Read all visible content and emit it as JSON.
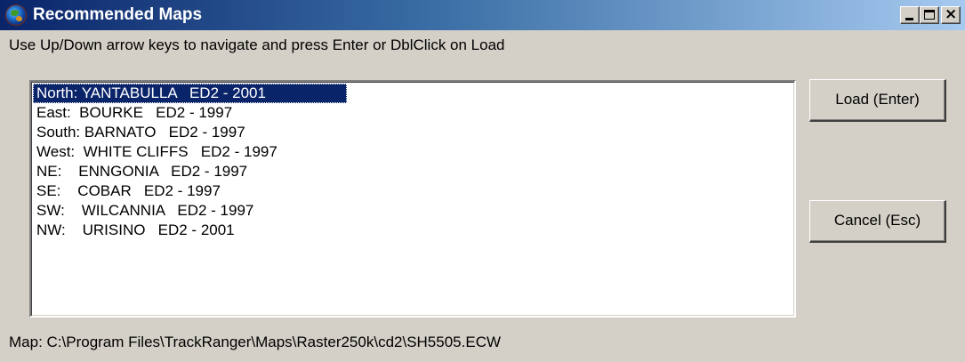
{
  "window": {
    "title": "Recommended Maps",
    "controls": {
      "minimize_icon": "minimize-icon",
      "maximize_icon": "maximize-icon",
      "close_icon": "close-icon",
      "close_glyph": "×"
    }
  },
  "instruction": "Use Up/Down arrow keys to navigate and press Enter or DblClick on Load",
  "maps_list": {
    "selected_index": 0,
    "items": [
      {
        "label": "North: YANTABULLA   ED2 - 2001"
      },
      {
        "label": "East:  BOURKE   ED2 - 1997"
      },
      {
        "label": "South: BARNATO   ED2 - 1997"
      },
      {
        "label": "West:  WHITE CLIFFS   ED2 - 1997"
      },
      {
        "label": "NE:    ENNGONIA   ED2 - 1997"
      },
      {
        "label": "SE:    COBAR   ED2 - 1997"
      },
      {
        "label": "SW:    WILCANNIA   ED2 - 1997"
      },
      {
        "label": "NW:    URISINO   ED2 - 2001"
      }
    ]
  },
  "buttons": {
    "load_label": "Load (Enter)",
    "cancel_label": "Cancel (Esc)"
  },
  "status": {
    "map_path": "Map: C:\\Program Files\\TrackRanger\\Maps\\Raster250k\\cd2\\SH5505.ECW"
  },
  "colors": {
    "titlebar_start": "#0a246a",
    "titlebar_end": "#a6caf0",
    "selection": "#0a246a",
    "face": "#d4d0c8"
  }
}
